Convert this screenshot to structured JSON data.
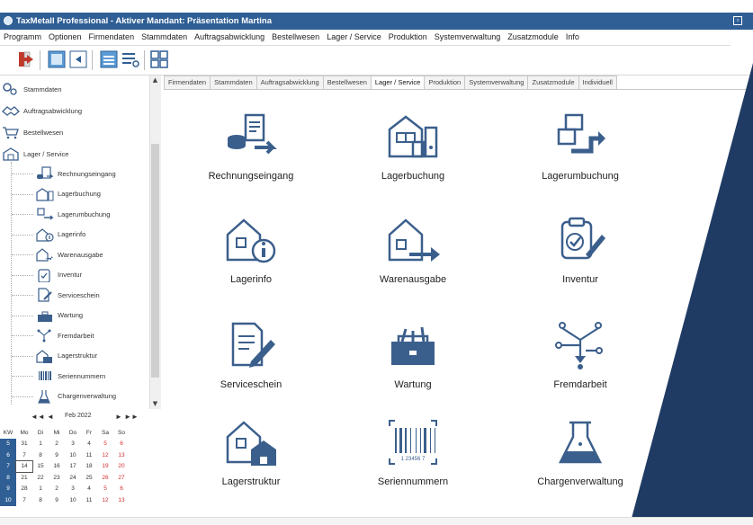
{
  "window": {
    "title": "TaxMetall Professional - Aktiver Mandant: Präsentation Martina"
  },
  "menu": [
    "Programm",
    "Optionen",
    "Firmendaten",
    "Stammdaten",
    "Auftragsabwicklung",
    "Bestellwesen",
    "Lager / Service",
    "Produktion",
    "Systemverwaltung",
    "Zusatzmodule",
    "Info"
  ],
  "toolbar": {
    "icons": [
      "exit-icon",
      "window-back-icon",
      "window-list-icon",
      "tile-icon"
    ]
  },
  "tree": {
    "roots": [
      {
        "label": "Stammdaten",
        "icon": "gears-icon"
      },
      {
        "label": "Auftragsabwicklung",
        "icon": "handshake-icon"
      },
      {
        "label": "Bestellwesen",
        "icon": "cart-icon"
      },
      {
        "label": "Lager / Service",
        "icon": "warehouse-icon"
      }
    ],
    "children": [
      {
        "label": "Rechnungseingang",
        "icon": "invoice-icon"
      },
      {
        "label": "Lagerbuchung",
        "icon": "storage-booking-icon"
      },
      {
        "label": "Lagerumbuchung",
        "icon": "transfer-icon"
      },
      {
        "label": "Lagerinfo",
        "icon": "info-icon"
      },
      {
        "label": "Warenausgabe",
        "icon": "dispatch-icon"
      },
      {
        "label": "Inventur",
        "icon": "clipboard-check-icon"
      },
      {
        "label": "Serviceschein",
        "icon": "document-pen-icon"
      },
      {
        "label": "Wartung",
        "icon": "toolbox-icon"
      },
      {
        "label": "Fremdarbeit",
        "icon": "workflow-icon"
      },
      {
        "label": "Lagerstruktur",
        "icon": "structure-icon"
      },
      {
        "label": "Seriennummern",
        "icon": "barcode-icon"
      },
      {
        "label": "Chargenverwaltung",
        "icon": "flask-icon"
      }
    ]
  },
  "calendar": {
    "month_label": "Feb 2022",
    "nav_prev": "◄◄ ◄",
    "nav_next": "► ►►",
    "headers": [
      "KW",
      "Mo",
      "Di",
      "Mi",
      "Do",
      "Fr",
      "Sa",
      "So"
    ],
    "rows": [
      [
        "5",
        "31",
        "1",
        "2",
        "3",
        "4",
        "5",
        "6"
      ],
      [
        "6",
        "7",
        "8",
        "9",
        "10",
        "11",
        "12",
        "13"
      ],
      [
        "7",
        "14",
        "15",
        "16",
        "17",
        "18",
        "19",
        "20"
      ],
      [
        "8",
        "21",
        "22",
        "23",
        "24",
        "25",
        "26",
        "27"
      ],
      [
        "9",
        "28",
        "1",
        "2",
        "3",
        "4",
        "5",
        "6"
      ],
      [
        "10",
        "7",
        "8",
        "9",
        "10",
        "11",
        "12",
        "13"
      ]
    ]
  },
  "tabs": [
    {
      "label": "Firmendaten",
      "active": false
    },
    {
      "label": "Stammdaten",
      "active": false
    },
    {
      "label": "Auftragsabwicklung",
      "active": false
    },
    {
      "label": "Bestellwesen",
      "active": false
    },
    {
      "label": "Lager / Service",
      "active": true
    },
    {
      "label": "Produktion",
      "active": false
    },
    {
      "label": "Systemverwaltung",
      "active": false
    },
    {
      "label": "Zusatzmodule",
      "active": false
    },
    {
      "label": "Individuell",
      "active": false
    }
  ],
  "tiles": [
    {
      "label": "Rechnungseingang",
      "icon": "invoice-icon"
    },
    {
      "label": "Lagerbuchung",
      "icon": "storage-booking-icon"
    },
    {
      "label": "Lagerumbuchung",
      "icon": "transfer-icon"
    },
    {
      "label": "Lagerinfo",
      "icon": "info-icon"
    },
    {
      "label": "Warenausgabe",
      "icon": "dispatch-icon"
    },
    {
      "label": "Inventur",
      "icon": "clipboard-check-icon"
    },
    {
      "label": "Serviceschein",
      "icon": "document-pen-icon"
    },
    {
      "label": "Wartung",
      "icon": "toolbox-icon"
    },
    {
      "label": "Fremdarbeit",
      "icon": "workflow-icon"
    },
    {
      "label": "Lagerstruktur",
      "icon": "structure-icon"
    },
    {
      "label": "Seriennummern",
      "icon": "barcode-icon",
      "barcode_text": "1 23456 7"
    },
    {
      "label": "Chargenverwaltung",
      "icon": "flask-icon"
    }
  ],
  "colors": {
    "title_bar": "#2f5f95",
    "icon_blue": "#3b5f8c",
    "overlay_navy": "#1f3b63"
  }
}
